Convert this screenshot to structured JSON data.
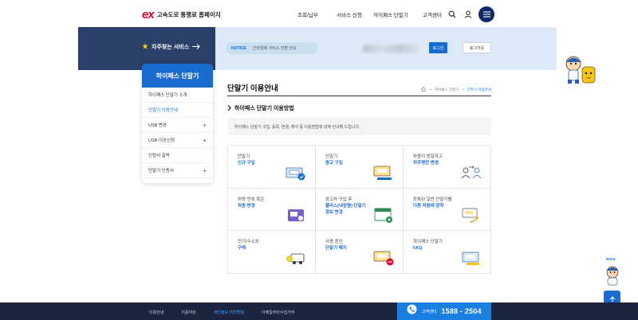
{
  "header": {
    "logo_mark": "ex",
    "logo_text": "고속도로 통행료 홈페이지",
    "nav": [
      "조회/납부",
      "서비스 신청",
      "하이패스 단말기",
      "고객센터"
    ]
  },
  "banner": {
    "favorite_label": "자주찾는 서비스",
    "notice_tag": "NOTICE",
    "notice_text": "간편결제 서비스 전환 안내",
    "login_label": "로그인",
    "logout_label": "로그아웃"
  },
  "side_nav": {
    "title": "하이패스 단말기",
    "items": [
      {
        "label": "하이패스 단말기 소개",
        "expand": ""
      },
      {
        "label": "단말기 이용안내",
        "expand": ""
      },
      {
        "label": "USB 변경",
        "expand": "+"
      },
      {
        "label": "USB 이관신청",
        "expand": "+"
      },
      {
        "label": "신청서 출력",
        "expand": ""
      },
      {
        "label": "단말기 인증서",
        "expand": "+"
      }
    ]
  },
  "content": {
    "page_title": "단말기 이용안내",
    "breadcrumb": [
      "하이패스 단말기",
      "단말기 이용안내"
    ],
    "section_title": "하이패스 단말기 이용방법",
    "description": "하이패스 단말기 구입, 등록, 변경, 해지 등 이용방법에 대해 안내해 드립니다.",
    "cards": [
      {
        "line1": "단말기",
        "line2": "신규 구입",
        "icon": "new-device-icon"
      },
      {
        "line1": "단말기",
        "line2": "중고 구입",
        "icon": "used-device-icon"
      },
      {
        "line1": "차종이 동일하고",
        "line2": "차주명만 변경",
        "icon": "owner-change-icon"
      },
      {
        "line1": "차량 번호 혹은",
        "line2": "차종 변경",
        "icon": "vehicle-change-icon"
      },
      {
        "line1": "중고차 구입 후",
        "line2": "플러스(내장형) 단말기\n정보 변경",
        "icon": "info-change-icon"
      },
      {
        "line1": "등록된 일반 단말기를",
        "line2": "다른 차량에 장착",
        "icon": "move-device-icon"
      },
      {
        "line1": "전기/수소차",
        "line2": "구매",
        "icon": "ev-icon"
      },
      {
        "line1": "사용 중인",
        "line2": "단말기 해지",
        "icon": "cancel-device-icon"
      },
      {
        "line1": "하이패스 단말기",
        "line2": "FAQ",
        "icon": "faq-icon"
      }
    ]
  },
  "footer": {
    "links": [
      "이용안내",
      "이용약관",
      "개인정보 처리방침",
      "이메일무단수집거부"
    ],
    "highlight_index": 2,
    "callcenter_label": "고객센터",
    "callcenter_number": "1588 - 2504"
  },
  "floating": {
    "notice_label": "NotiX"
  },
  "colors": {
    "primary": "#1a6bd0",
    "navy": "#0d2a6b",
    "brand_red": "#e4002b",
    "footer": "#1b2540"
  }
}
